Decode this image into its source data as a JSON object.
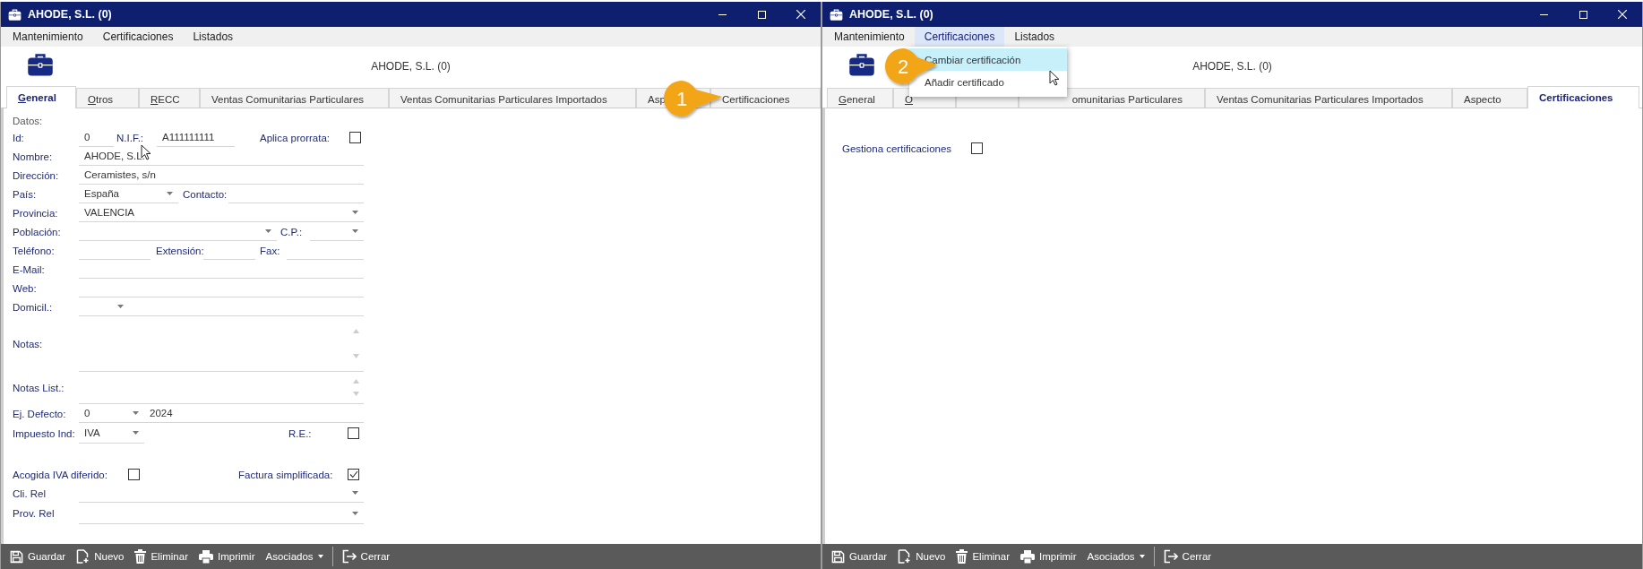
{
  "windows": [
    {
      "title": "AHODE, S.L. (0)",
      "menu": [
        {
          "label": "Mantenimiento",
          "selected": false
        },
        {
          "label": "Certificaciones",
          "selected": false
        },
        {
          "label": "Listados",
          "selected": false
        }
      ],
      "header": "AHODE, S.L. (0)",
      "tabs": [
        {
          "label": "General",
          "selected": true,
          "accel": true
        },
        {
          "label": "Otros",
          "selected": false,
          "accel": true
        },
        {
          "label": "RECC",
          "selected": false,
          "accel": true
        },
        {
          "label": "Ventas Comunitarias Particulares",
          "selected": false
        },
        {
          "label": "Ventas Comunitarias Particulares Importados",
          "selected": false
        },
        {
          "label": "Asp",
          "selected": false
        },
        {
          "label": "Certificaciones",
          "selected": false
        }
      ],
      "panel": {
        "kind": "general",
        "rows": [
          {
            "items": [
              {
                "kind": "section",
                "text": "Datos:"
              }
            ]
          },
          {
            "items": [
              {
                "kind": "label",
                "text": "Id:"
              },
              {
                "kind": "text",
                "value": "0"
              },
              {
                "kind": "label",
                "text": "N.I.F.:"
              },
              {
                "kind": "text",
                "value": "A111111111"
              },
              {
                "kind": "label",
                "text": "Aplica prorrata:"
              },
              {
                "kind": "checkbox",
                "checked": false
              }
            ]
          },
          {
            "items": [
              {
                "kind": "label",
                "text": "Nombre:"
              },
              {
                "kind": "text",
                "value": "AHODE, S.L."
              }
            ]
          },
          {
            "items": [
              {
                "kind": "label",
                "text": "Dirección:"
              },
              {
                "kind": "text",
                "value": "Ceramistes, s/n"
              }
            ]
          },
          {
            "items": [
              {
                "kind": "label",
                "text": "País:"
              },
              {
                "kind": "combo",
                "value": "España"
              },
              {
                "kind": "label",
                "text": "Contacto:"
              },
              {
                "kind": "text"
              }
            ]
          },
          {
            "items": [
              {
                "kind": "label",
                "text": "Provincia:"
              },
              {
                "kind": "combo",
                "value": "VALENCIA"
              }
            ]
          },
          {
            "items": [
              {
                "kind": "label",
                "text": "Población:"
              },
              {
                "kind": "combo"
              },
              {
                "kind": "label",
                "text": "C.P.:"
              },
              {
                "kind": "combo"
              }
            ]
          },
          {
            "items": [
              {
                "kind": "label",
                "text": "Teléfono:"
              },
              {
                "kind": "text"
              },
              {
                "kind": "label",
                "text": "Extensión:"
              },
              {
                "kind": "text"
              },
              {
                "kind": "label",
                "text": "Fax:"
              },
              {
                "kind": "text"
              }
            ]
          },
          {
            "items": [
              {
                "kind": "label",
                "text": "E-Mail:"
              },
              {
                "kind": "text"
              }
            ]
          },
          {
            "items": [
              {
                "kind": "label",
                "text": "Web:"
              },
              {
                "kind": "text"
              }
            ]
          },
          {
            "items": [
              {
                "kind": "label",
                "text": "Domicil.:"
              },
              {
                "kind": "combo"
              },
              {
                "kind": "text"
              }
            ]
          },
          {
            "items": [
              {
                "kind": "label",
                "text": "Notas:"
              },
              {
                "kind": "memo"
              }
            ]
          },
          {
            "items": [
              {
                "kind": "label",
                "text": "Notas List.:"
              },
              {
                "kind": "memo"
              }
            ]
          },
          {
            "items": [
              {
                "kind": "label",
                "text": "Ej. Defecto:"
              },
              {
                "kind": "combo",
                "value": "0"
              },
              {
                "kind": "text",
                "value": "2024"
              }
            ]
          },
          {
            "items": [
              {
                "kind": "label",
                "text": "Impuesto Ind:"
              },
              {
                "kind": "combo",
                "value": "IVA"
              },
              {
                "kind": "label",
                "text": "R.E.:"
              },
              {
                "kind": "checkbox",
                "checked": false
              }
            ]
          },
          {
            "items": [
              {
                "kind": "label",
                "text": "Acogida IVA diferido:"
              },
              {
                "kind": "checkbox",
                "checked": false
              },
              {
                "kind": "label",
                "text": "Factura simplificada:"
              },
              {
                "kind": "checkbox",
                "checked": true
              }
            ]
          },
          {
            "items": [
              {
                "kind": "label",
                "text": "Cli. Rel"
              },
              {
                "kind": "combo"
              }
            ]
          },
          {
            "items": [
              {
                "kind": "label",
                "text": "Prov. Rel"
              },
              {
                "kind": "combo"
              }
            ]
          }
        ]
      },
      "toolbar": [
        {
          "label": "Guardar",
          "kind": "save"
        },
        {
          "label": "Nuevo",
          "kind": "new"
        },
        {
          "label": "Eliminar",
          "kind": "delete"
        },
        {
          "label": "Imprimir",
          "kind": "print"
        },
        {
          "label": "Asociados",
          "kind": "dropdown"
        },
        {
          "label": "Cerrar",
          "kind": "exit"
        }
      ],
      "callout": {
        "number": "1"
      }
    },
    {
      "title": "AHODE, S.L. (0)",
      "menu": [
        {
          "label": "Mantenimiento",
          "selected": false
        },
        {
          "label": "Certificaciones",
          "selected": true
        },
        {
          "label": "Listados",
          "selected": false
        }
      ],
      "header": "AHODE, S.L. (0)",
      "tabs": [
        {
          "label": "General",
          "selected": false,
          "accel": true
        },
        {
          "label": "O",
          "selected": false,
          "accel": true
        },
        {
          "selected": false
        },
        {
          "label": "omunitarias Particulares",
          "selected": false,
          "kind": "clipped"
        },
        {
          "label": "Ventas Comunitarias Particulares Importados",
          "selected": false
        },
        {
          "label": "Aspecto",
          "selected": false
        },
        {
          "label": "Certificaciones",
          "selected": true
        }
      ],
      "panel": {
        "kind": "certificaciones",
        "rows": [
          {
            "items": [
              {
                "kind": "label",
                "text": "Gestiona certificaciones"
              },
              {
                "kind": "checkbox",
                "checked": false
              }
            ]
          }
        ]
      },
      "dropdown": [
        {
          "label": "Cambiar certificación",
          "selected": true
        },
        {
          "label": "Añadir certificado",
          "selected": false
        }
      ],
      "toolbar": [
        {
          "label": "Guardar",
          "kind": "save"
        },
        {
          "label": "Nuevo",
          "kind": "new"
        },
        {
          "label": "Eliminar",
          "kind": "delete"
        },
        {
          "label": "Imprimir",
          "kind": "print"
        },
        {
          "label": "Asociados",
          "kind": "dropdown"
        },
        {
          "label": "Cerrar",
          "kind": "exit"
        }
      ],
      "callout": {
        "number": "2"
      }
    }
  ]
}
